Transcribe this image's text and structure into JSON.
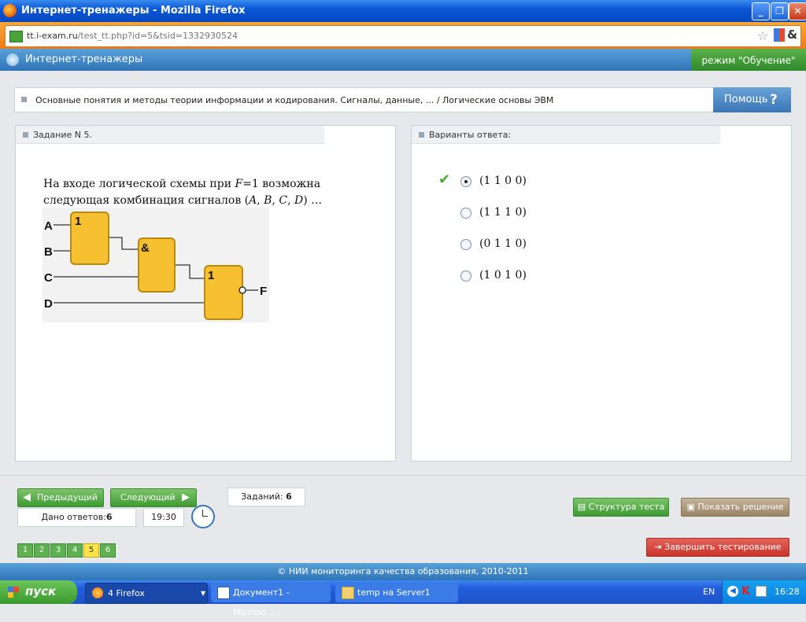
{
  "window": {
    "title": "Интернет-тренажеры - Mozilla Firefox"
  },
  "browser": {
    "url_host": "tt.i-exam.ru",
    "url_path": "/test_tt.php?id=5&tsid=1332930524"
  },
  "app": {
    "title": "Интернет-тренажеры",
    "mode": "режим \"Обучение\""
  },
  "breadcrumb": "Основные понятия и методы теории информации и кодирования. Сигналы, данные, ... / Логические основы ЭВМ",
  "help_label": "Помощь",
  "task_panel": {
    "header": "Задание N 5.",
    "question_prefix": "На входе логической схемы при ",
    "question_var": "F",
    "question_rest": "=1 возможна следующая комбинация сигналов (",
    "question_vars": [
      "A",
      "B",
      "C",
      "D"
    ],
    "question_suffix": ") …"
  },
  "circuit": {
    "inputs": [
      "A",
      "B",
      "C",
      "D"
    ],
    "gates": [
      "1",
      "&",
      "1"
    ],
    "output": "F"
  },
  "answers_panel": {
    "header": "Варианты ответа:",
    "options": [
      {
        "text": "(1 1 0 0)",
        "selected": true
      },
      {
        "text": "(1 1 1 0)",
        "selected": false
      },
      {
        "text": "(0 1 1 0)",
        "selected": false
      },
      {
        "text": "(1 0 1 0)",
        "selected": false
      }
    ]
  },
  "nav": {
    "prev": "Предыдущий",
    "next": "Следующий",
    "tasks_label": "Заданий:",
    "tasks_value": "6",
    "answers_label": "Дано ответов:",
    "answers_value": "6",
    "timer": "19:30",
    "pages": [
      "1",
      "2",
      "3",
      "4",
      "5",
      "6"
    ],
    "current_page": "5"
  },
  "actions": {
    "structure": "Структура теста",
    "solution": "Показать решение",
    "finish": "Завершить тестирование"
  },
  "footer": "© НИИ мониторинга качества образования, 2010-2011",
  "taskbar": {
    "start": "пуск",
    "tasks": [
      "4 Firefox",
      "Документ1 - Microso...",
      "temp на Server1"
    ],
    "lang": "EN",
    "clock": "16:28"
  },
  "colors": {
    "accent_blue": "#2f74b8",
    "green": "#4ba63a",
    "current_page": "#ffe44a",
    "finish_red": "#c8342a"
  }
}
